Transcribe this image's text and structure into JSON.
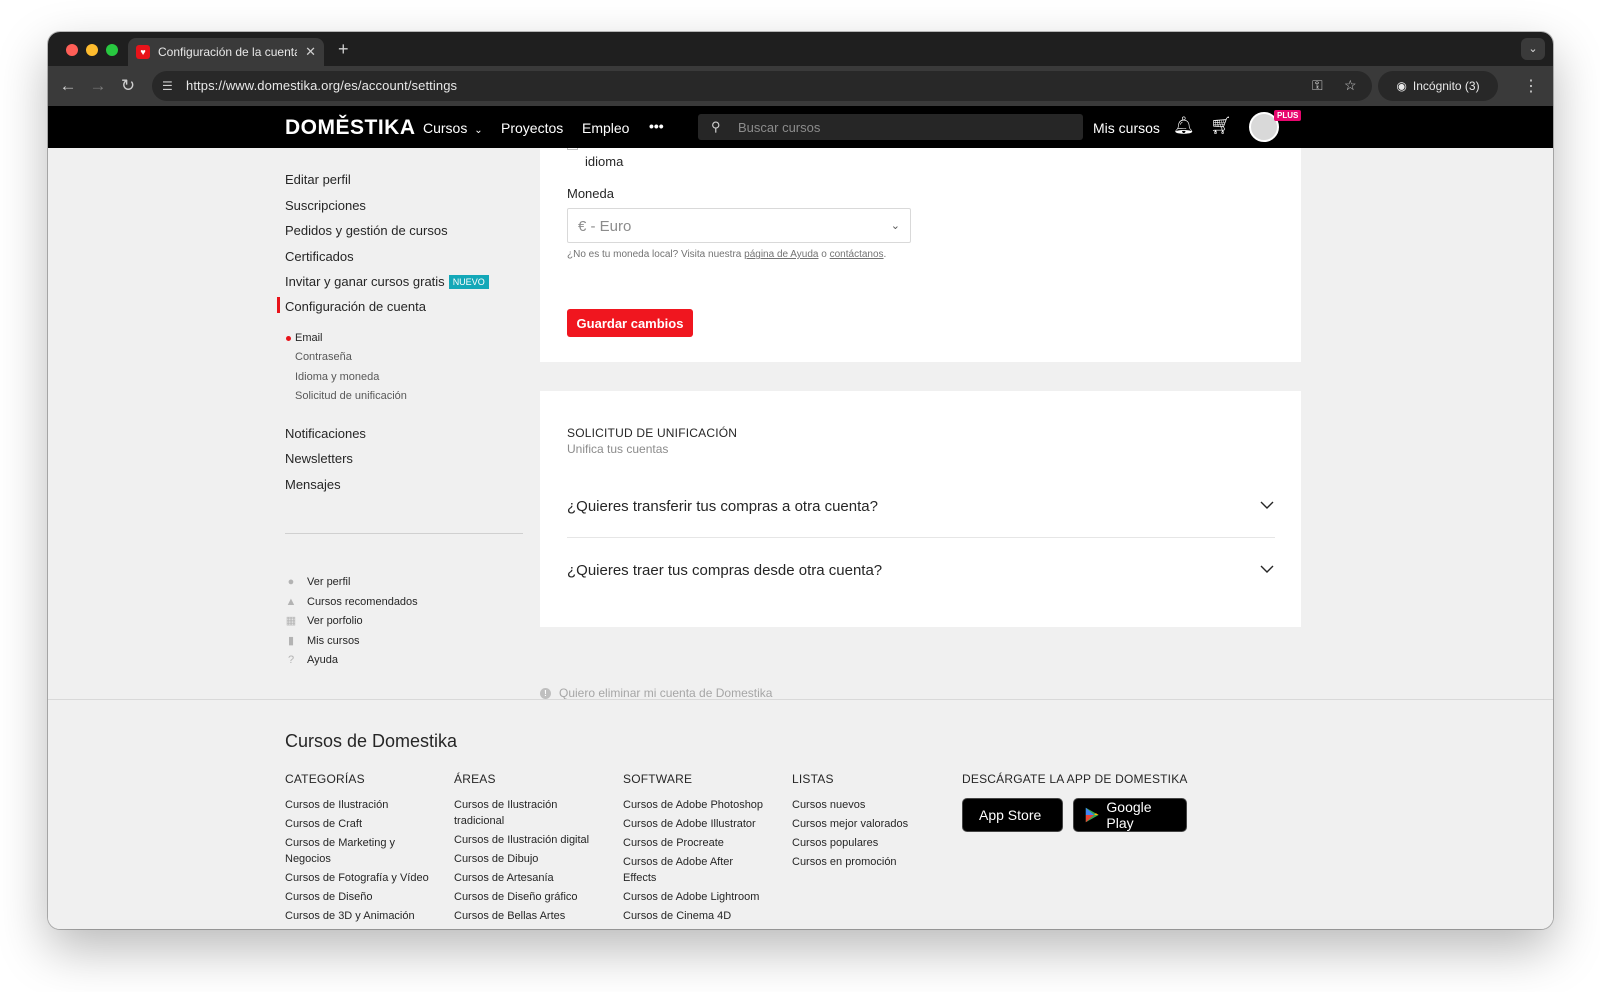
{
  "browser": {
    "tab_title": "Configuración de la cuenta | D",
    "url": "https://www.domestika.org/es/account/settings",
    "incognito_label": "Incógnito (3)"
  },
  "header": {
    "logo": "DOMĚSTIKA",
    "nav": [
      "Cursos",
      "Proyectos",
      "Empleo"
    ],
    "more": "•••",
    "search_placeholder": "Buscar cursos",
    "my_courses": "Mis cursos",
    "plus_badge": "PLUS"
  },
  "sidebar": {
    "items": [
      "Editar perfil",
      "Suscripciones",
      "Pedidos y gestión de cursos",
      "Certificados",
      "Invitar y ganar cursos gratis",
      "Configuración de cuenta"
    ],
    "new_badge": "NUEVO",
    "subitems": [
      "Email",
      "Contraseña",
      "Idioma y moneda",
      "Solicitud de unificación"
    ],
    "items2": [
      "Notificaciones",
      "Newsletters",
      "Mensajes"
    ],
    "aux_links": [
      "Ver perfil",
      "Cursos recomendados",
      "Ver porfolio",
      "Mis cursos",
      "Ayuda"
    ]
  },
  "currency_card": {
    "partial_text": "idioma",
    "label": "Moneda",
    "selected": "€ - Euro",
    "helper_prefix": "¿No es tu moneda local? Visita nuestra",
    "help_link": "página de Ayuda",
    "helper_mid": "o",
    "contact_link": "contáctanos",
    "helper_end": ".",
    "save_button": "Guardar cambios"
  },
  "merge_card": {
    "title": "SOLICITUD DE UNIFICACIÓN",
    "subtitle": "Unifica tus cuentas",
    "questions": [
      "¿Quieres transferir tus compras a otra cuenta?",
      "¿Quieres traer tus compras desde otra cuenta?"
    ]
  },
  "delete_account": "Quiero eliminar mi cuenta de Domestika",
  "footer": {
    "title": "Cursos de Domestika",
    "columns": [
      {
        "heading": "CATEGORÍAS",
        "items": [
          "Cursos de Ilustración",
          "Cursos de Craft",
          "Cursos de Marketing y Negocios",
          "Cursos de Fotografía y Vídeo",
          "Cursos de Diseño",
          "Cursos de 3D y Animación"
        ]
      },
      {
        "heading": "ÁREAS",
        "items": [
          "Cursos de Ilustración tradicional",
          "Cursos de Ilustración digital",
          "Cursos de Dibujo",
          "Cursos de Artesanía",
          "Cursos de Diseño gráfico",
          "Cursos de Bellas Artes"
        ]
      },
      {
        "heading": "SOFTWARE",
        "items": [
          "Cursos de Adobe Photoshop",
          "Cursos de Adobe Illustrator",
          "Cursos de Procreate",
          "Cursos de Adobe After Effects",
          "Cursos de Adobe Lightroom",
          "Cursos de Cinema 4D"
        ]
      },
      {
        "heading": "LISTAS",
        "items": [
          "Cursos nuevos",
          "Cursos mejor valorados",
          "Cursos populares",
          "Cursos en promoción"
        ]
      }
    ],
    "app_heading": "DESCÁRGATE LA APP DE DOMESTIKA",
    "app_store": "App Store",
    "google_play": "Google Play"
  },
  "colors": {
    "accent_red": "#f0161f",
    "badge_teal": "#13a8b8",
    "plus_pink": "#e8066e"
  }
}
